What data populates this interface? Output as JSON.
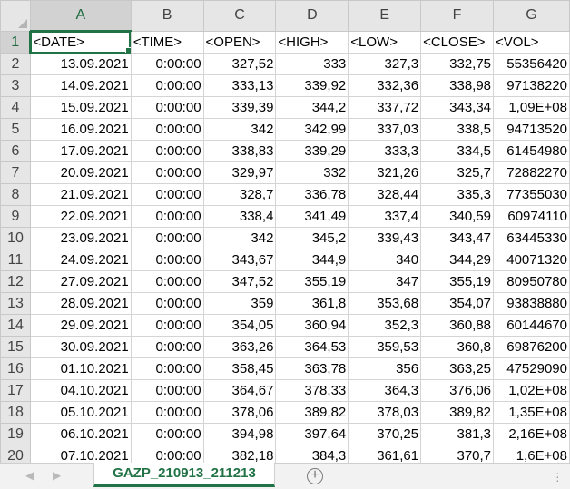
{
  "columns": [
    "A",
    "B",
    "C",
    "D",
    "E",
    "F",
    "G"
  ],
  "active_column": "A",
  "active_row": 1,
  "rows": [
    {
      "n": "1",
      "cells": [
        "<DATE>",
        "<TIME>",
        "<OPEN>",
        "<HIGH>",
        "<LOW>",
        "<CLOSE>",
        "<VOL>"
      ]
    },
    {
      "n": "2",
      "cells": [
        "13.09.2021",
        "0:00:00",
        "327,52",
        "333",
        "327,3",
        "332,75",
        "55356420"
      ]
    },
    {
      "n": "3",
      "cells": [
        "14.09.2021",
        "0:00:00",
        "333,13",
        "339,92",
        "332,36",
        "338,98",
        "97138220"
      ]
    },
    {
      "n": "4",
      "cells": [
        "15.09.2021",
        "0:00:00",
        "339,39",
        "344,2",
        "337,72",
        "343,34",
        "1,09E+08"
      ]
    },
    {
      "n": "5",
      "cells": [
        "16.09.2021",
        "0:00:00",
        "342",
        "342,99",
        "337,03",
        "338,5",
        "94713520"
      ]
    },
    {
      "n": "6",
      "cells": [
        "17.09.2021",
        "0:00:00",
        "338,83",
        "339,29",
        "333,3",
        "334,5",
        "61454980"
      ]
    },
    {
      "n": "7",
      "cells": [
        "20.09.2021",
        "0:00:00",
        "329,97",
        "332",
        "321,26",
        "325,7",
        "72882270"
      ]
    },
    {
      "n": "8",
      "cells": [
        "21.09.2021",
        "0:00:00",
        "328,7",
        "336,78",
        "328,44",
        "335,3",
        "77355030"
      ]
    },
    {
      "n": "9",
      "cells": [
        "22.09.2021",
        "0:00:00",
        "338,4",
        "341,49",
        "337,4",
        "340,59",
        "60974110"
      ]
    },
    {
      "n": "10",
      "cells": [
        "23.09.2021",
        "0:00:00",
        "342",
        "345,2",
        "339,43",
        "343,47",
        "63445330"
      ]
    },
    {
      "n": "11",
      "cells": [
        "24.09.2021",
        "0:00:00",
        "343,67",
        "344,9",
        "340",
        "344,29",
        "40071320"
      ]
    },
    {
      "n": "12",
      "cells": [
        "27.09.2021",
        "0:00:00",
        "347,52",
        "355,19",
        "347",
        "355,19",
        "80950780"
      ]
    },
    {
      "n": "13",
      "cells": [
        "28.09.2021",
        "0:00:00",
        "359",
        "361,8",
        "353,68",
        "354,07",
        "93838880"
      ]
    },
    {
      "n": "14",
      "cells": [
        "29.09.2021",
        "0:00:00",
        "354,05",
        "360,94",
        "352,3",
        "360,88",
        "60144670"
      ]
    },
    {
      "n": "15",
      "cells": [
        "30.09.2021",
        "0:00:00",
        "363,26",
        "364,53",
        "359,53",
        "360,8",
        "69876200"
      ]
    },
    {
      "n": "16",
      "cells": [
        "01.10.2021",
        "0:00:00",
        "358,45",
        "363,78",
        "356",
        "363,25",
        "47529090"
      ]
    },
    {
      "n": "17",
      "cells": [
        "04.10.2021",
        "0:00:00",
        "364,67",
        "378,33",
        "364,3",
        "376,06",
        "1,02E+08"
      ]
    },
    {
      "n": "18",
      "cells": [
        "05.10.2021",
        "0:00:00",
        "378,06",
        "389,82",
        "378,03",
        "389,82",
        "1,35E+08"
      ]
    },
    {
      "n": "19",
      "cells": [
        "06.10.2021",
        "0:00:00",
        "394,98",
        "397,64",
        "370,25",
        "381,3",
        "2,16E+08"
      ]
    },
    {
      "n": "20",
      "cells": [
        "07.10.2021",
        "0:00:00",
        "382,18",
        "384,3",
        "361,61",
        "370,7",
        "1,6E+08"
      ]
    }
  ],
  "sheet_tab": "GAZP_210913_211213",
  "add_sheet_symbol": "+",
  "nav_prev_icon": "◀",
  "nav_next_icon": "▶",
  "accent_color": "#217346"
}
